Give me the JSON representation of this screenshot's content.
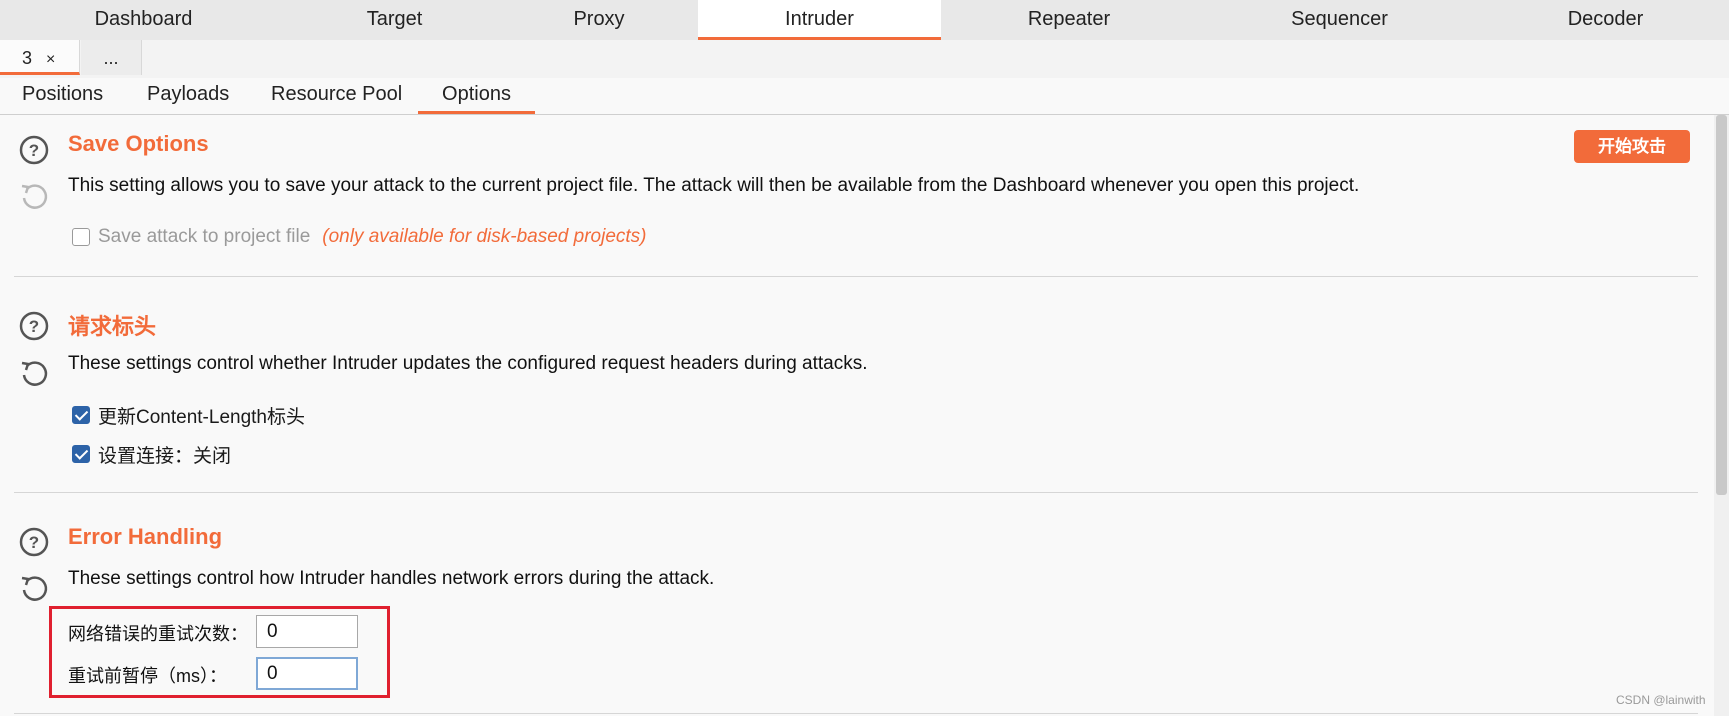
{
  "top_tabs": [
    "Dashboard",
    "Target",
    "Proxy",
    "Intruder",
    "Repeater",
    "Sequencer",
    "Decoder"
  ],
  "active_top_tab": "Intruder",
  "instance_tabs": {
    "current": "3",
    "close_glyph": "×",
    "more": "..."
  },
  "sub_tabs": [
    "Positions",
    "Payloads",
    "Resource Pool",
    "Options"
  ],
  "active_sub_tab": "Options",
  "start_attack_button": "开始攻击",
  "sections": {
    "save_options": {
      "title": "Save Options",
      "description": "This setting allows you to save your attack to the current project file. The attack will then be available from the Dashboard whenever you open this project.",
      "checkbox_label": "Save attack to project file",
      "checkbox_checked": false,
      "note": "(only available for disk-based projects)"
    },
    "request_headers": {
      "title": "请求标头",
      "description": "These settings control whether Intruder updates the configured request headers during attacks.",
      "options": [
        {
          "label": "更新Content-Length标头",
          "checked": true
        },
        {
          "label": "设置连接：关闭",
          "checked": true
        }
      ]
    },
    "error_handling": {
      "title": "Error Handling",
      "description": "These settings control how Intruder handles network errors during the attack.",
      "fields": [
        {
          "label": "网络错误的重试次数：",
          "value": "0"
        },
        {
          "label": "重试前暂停（ms）：",
          "value": "0"
        }
      ]
    }
  },
  "watermark": "CSDN @lainwith",
  "colors": {
    "accent": "#f26b3a",
    "checkbox": "#2d63a8",
    "highlight": "#e0202f"
  }
}
